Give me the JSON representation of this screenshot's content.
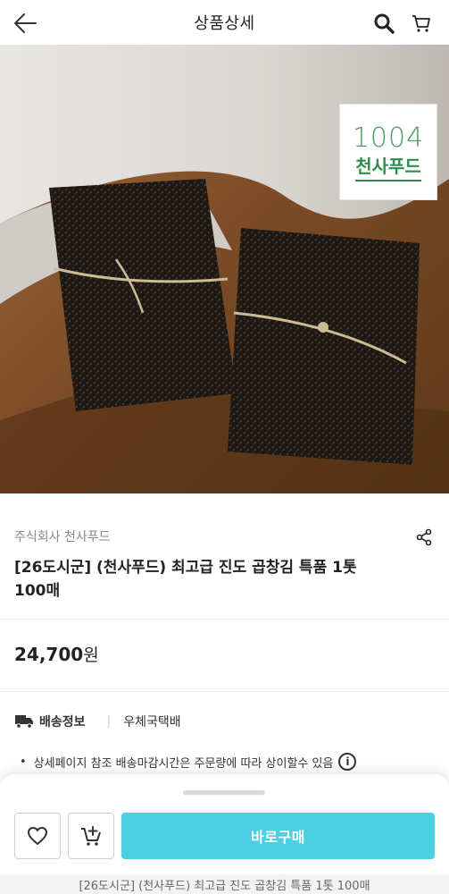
{
  "header": {
    "title": "상품상세",
    "back_icon": "arrow-left-icon",
    "search_icon": "search-icon",
    "cart_icon": "cart-icon"
  },
  "hero": {
    "logo_number": "1004",
    "logo_name": "천사푸드",
    "slide_count": 2,
    "active_slide": 1
  },
  "product": {
    "seller": "주식회사 천사푸드",
    "title": "[26도시군] (천사푸드) 최고급 진도 곱창김 특품 1톳 100매",
    "price": "24,700",
    "price_unit": "원"
  },
  "shipping": {
    "label": "배송정보",
    "separator": "|",
    "method": "우체국택배",
    "notice": "상세페이지 참조 배송마감시간은 주문량에 따라 상이할수 있음",
    "info_glyph": "i"
  },
  "actions": {
    "buy_label": "바로구매",
    "wish_icon": "heart-icon",
    "add_cart_icon": "cart-add-icon"
  },
  "footer": {
    "text": "[26도시군] (천사푸드) 최고급 진도 곱창김 특품 1톳 100매"
  },
  "colors": {
    "accent": "#4ccfe0",
    "brand_green": "#2e8d4e"
  }
}
